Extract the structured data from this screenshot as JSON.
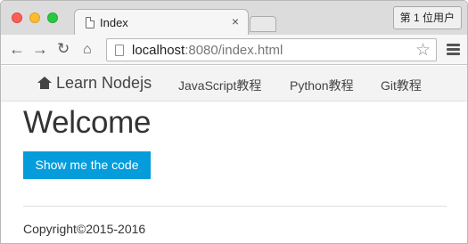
{
  "browser": {
    "tab_title": "Index",
    "tab_close": "×",
    "user_button": "第 1 位用户",
    "address_host": "localhost",
    "address_rest": ":8080/index.html",
    "icons": {
      "back": "arrow-left-icon",
      "forward": "arrow-right-icon",
      "reload": "reload-icon",
      "home": "home-icon",
      "bookmark": "star-icon",
      "menu": "hamburger-menu-icon"
    }
  },
  "navbar": {
    "brand": "Learn Nodejs",
    "links": [
      "JavaScript教程",
      "Python教程",
      "Git教程"
    ]
  },
  "main": {
    "heading": "Welcome",
    "button_label": "Show me the code"
  },
  "footer": {
    "copyright": "Copyright©2015-2016"
  },
  "colors": {
    "button": "#049cdb",
    "navbar_bg": "#f3f3f3",
    "close": "#fc5f57",
    "minimize": "#fdbc2e",
    "maximize": "#28c840"
  }
}
